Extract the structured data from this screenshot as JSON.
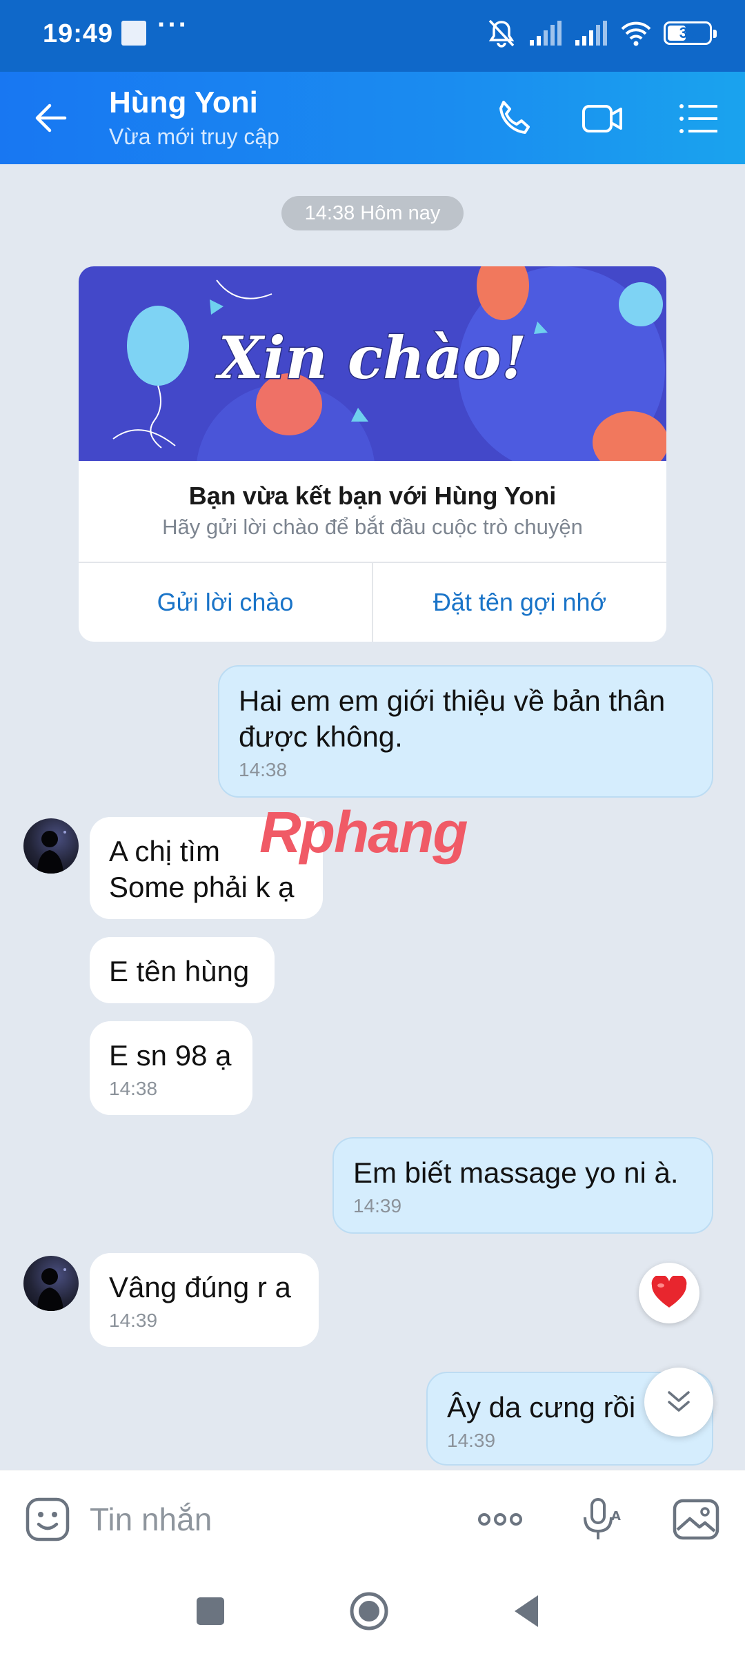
{
  "status_bar": {
    "time": "19:49",
    "dots": "···",
    "battery": "33"
  },
  "header": {
    "contact_name": "Hùng Yoni",
    "contact_status": "Vừa mới truy cập",
    "icons": [
      "back-arrow-icon",
      "phone-icon",
      "video-call-icon",
      "menu-icon"
    ]
  },
  "chat": {
    "date_label": "14:38 Hôm nay",
    "friend_card": {
      "banner_text": "Xin chào!",
      "title": "Bạn vừa kết bạn với Hùng Yoni",
      "subtitle": "Hãy gửi lời chào để bắt đầu cuộc trò chuyện",
      "button_left": "Gửi lời chào",
      "button_right": "Đặt tên gợi nhớ"
    },
    "messages": [
      {
        "dir": "out",
        "text": "Hai em em giới thiệu về bản thân được không.",
        "time": "14:38"
      },
      {
        "dir": "in",
        "text": "A chị tìm Some phải k ạ",
        "time": ""
      },
      {
        "dir": "in",
        "text": "E tên hùng",
        "time": ""
      },
      {
        "dir": "in",
        "text": "E sn 98 ạ",
        "time": "14:38"
      },
      {
        "dir": "out",
        "text": "Em biết massage yo ni à.",
        "time": "14:39"
      },
      {
        "dir": "in",
        "text": "Vâng đúng r a",
        "time": "14:39"
      },
      {
        "dir": "out",
        "text": "Ây da cưng rồi",
        "time": "14:39"
      }
    ],
    "watermark": "Rphang",
    "colors": {
      "out_bubble": "#d5edfd",
      "in_bubble": "#ffffff",
      "header": "#1877f2",
      "link": "#1a74c8"
    }
  },
  "input": {
    "placeholder": "Tin nhắn",
    "icons": [
      "sticker-icon",
      "more-icon",
      "voice-icon",
      "image-icon"
    ]
  },
  "navbar": {
    "icons": [
      "recents-icon",
      "home-icon",
      "back-icon"
    ]
  }
}
